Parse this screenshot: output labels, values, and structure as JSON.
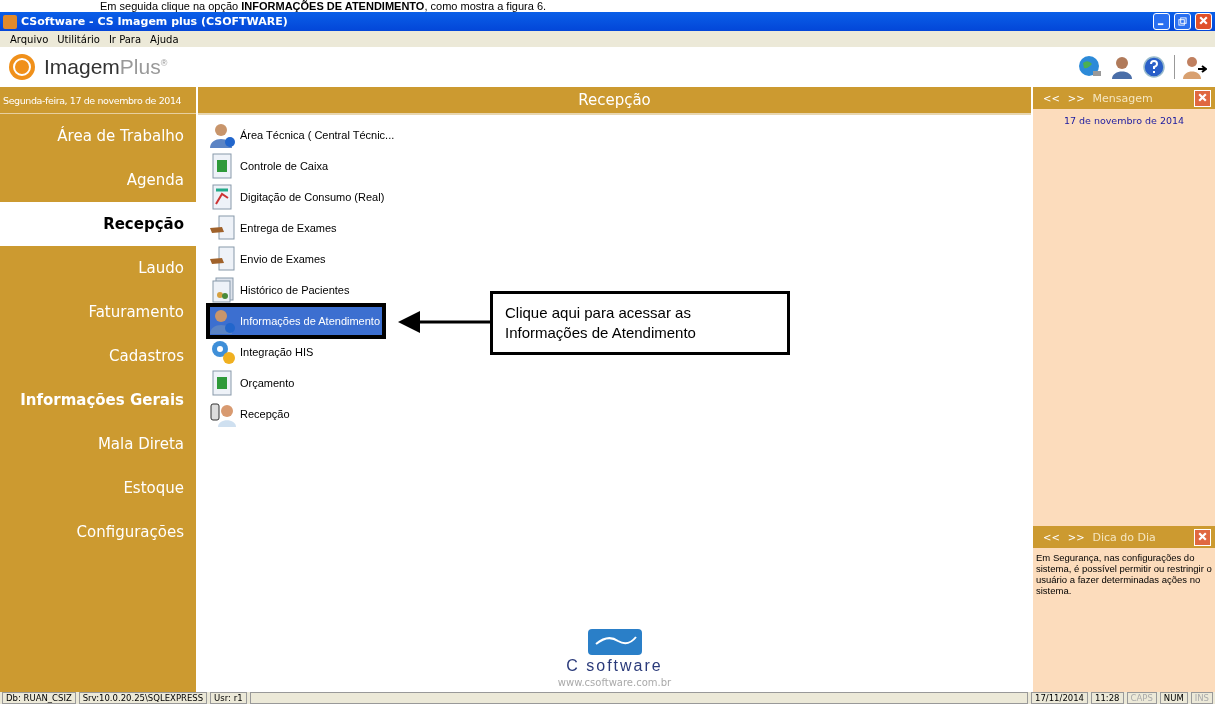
{
  "document_caption": "Em seguida clique na opção **INFORMAÇÕES DE ATENDIMENTO**, como mostra a figura 6.",
  "window": {
    "title": "CSoftware - CS Imagem plus (CSOFTWARE)"
  },
  "menu_bar": [
    "Arquivo",
    "Utilitário",
    "Ir Para",
    "Ajuda"
  ],
  "brand": {
    "name": "Imagem",
    "suffix": "Plus",
    "mark": "®"
  },
  "sidebar": {
    "date": "Segunda-feira, 17 de novembro de 2014",
    "items": [
      {
        "label": "Área de Trabalho",
        "selected": false,
        "bold": false
      },
      {
        "label": "Agenda",
        "selected": false,
        "bold": false
      },
      {
        "label": "Recepção",
        "selected": true,
        "bold": true
      },
      {
        "label": "Laudo",
        "selected": false,
        "bold": false
      },
      {
        "label": "Faturamento",
        "selected": false,
        "bold": false
      },
      {
        "label": "Cadastros",
        "selected": false,
        "bold": false
      },
      {
        "label": "Informações Gerais",
        "selected": false,
        "bold": true
      },
      {
        "label": "Mala Direta",
        "selected": false,
        "bold": false
      },
      {
        "label": "Estoque",
        "selected": false,
        "bold": false
      },
      {
        "label": "Configurações",
        "selected": false,
        "bold": false
      }
    ]
  },
  "main": {
    "title": "Recepção",
    "items": [
      {
        "label": "Área Técnica ( Central Técnic...",
        "kind": "person",
        "selected": false
      },
      {
        "label": "Controle de Caixa",
        "kind": "money",
        "selected": false
      },
      {
        "label": "Digitação de Consumo (Real)",
        "kind": "chart",
        "selected": false
      },
      {
        "label": "Entrega de Exames",
        "kind": "hand",
        "selected": false
      },
      {
        "label": "Envio de Exames",
        "kind": "hand",
        "selected": false
      },
      {
        "label": "Histórico de Pacientes",
        "kind": "history",
        "selected": false
      },
      {
        "label": "Informações de Atendimento",
        "kind": "person",
        "selected": true
      },
      {
        "label": "Integração HIS",
        "kind": "gear",
        "selected": false
      },
      {
        "label": "Orçamento",
        "kind": "money",
        "selected": false
      },
      {
        "label": "Recepção",
        "kind": "phone",
        "selected": false
      }
    ],
    "callout": "Clique aqui para acessar as Informações de Atendimento",
    "footer_logo": "C software",
    "footer_url": "www.csoftware.com.br"
  },
  "message_panel": {
    "prev": "<<",
    "next": ">>",
    "title": "Mensagem",
    "date": "17 de novembro de 2014"
  },
  "tip_panel": {
    "prev": "<<",
    "next": ">>",
    "title": "Dica do Dia",
    "text": "Em Segurança, nas configurações do sistema, é possível permitir ou restringir o usuário a fazer determinadas ações no sistema."
  },
  "status_bar": [
    {
      "text": "Db: RUAN_CSIZ",
      "enabled": true
    },
    {
      "text": "Srv:10.0.20.25\\SQLEXPRESS",
      "enabled": true
    },
    {
      "text": "Usr: r1",
      "enabled": true
    },
    {
      "text": "17/11/2014",
      "enabled": true
    },
    {
      "text": "11:28",
      "enabled": true
    },
    {
      "text": "CAPS",
      "enabled": false
    },
    {
      "text": "NUM",
      "enabled": true
    },
    {
      "text": "INS",
      "enabled": false
    }
  ]
}
